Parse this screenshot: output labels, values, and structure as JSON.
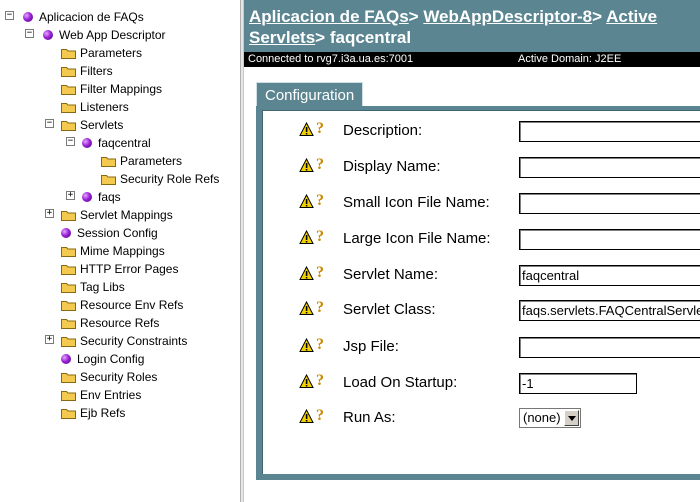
{
  "tree": {
    "root": "Aplicacion de FAQs",
    "descriptor": "Web App Descriptor",
    "parameters": "Parameters",
    "filters": "Filters",
    "filter_mappings": "Filter Mappings",
    "listeners": "Listeners",
    "servlets": "Servlets",
    "faqcentral": "faqcentral",
    "faqcentral_parameters": "Parameters",
    "security_role_refs": "Security Role Refs",
    "faqs": "faqs",
    "servlet_mappings": "Servlet Mappings",
    "session_config": "Session Config",
    "mime_mappings": "Mime Mappings",
    "http_error_pages": "HTTP Error Pages",
    "tag_libs": "Tag Libs",
    "resource_env_refs": "Resource Env Refs",
    "resource_refs": "Resource Refs",
    "security_constraints": "Security Constraints",
    "login_config": "Login Config",
    "security_roles": "Security Roles",
    "env_entries": "Env Entries",
    "ejb_refs": "Ejb Refs"
  },
  "header": {
    "crumb1": "Aplicacion de FAQs",
    "sep1": "> ",
    "crumb2": "WebAppDescriptor-8",
    "sep2": "> ",
    "crumb3a": "Active",
    "crumb3b": "Servlets",
    "sep3": "> ",
    "current": "faqcentral"
  },
  "status": {
    "connected": "Connected to rvg7.i3a.ua.es:7001",
    "domain": "Active Domain: J2EE"
  },
  "tab": {
    "configuration": "Configuration"
  },
  "form": {
    "description_label": "Description",
    "description_value": "",
    "display_name_label": "Display Name",
    "display_name_value": "",
    "small_icon_label": "Small Icon File Name",
    "small_icon_value": "",
    "large_icon_label": "Large Icon File Name",
    "large_icon_value": "",
    "servlet_name_label": "Servlet Name",
    "servlet_name_value": "faqcentral",
    "servlet_class_label": "Servlet Class",
    "servlet_class_value": "faqs.servlets.FAQCentralServlet",
    "jsp_file_label": "Jsp File",
    "jsp_file_value": "",
    "load_on_startup_label": "Load On Startup",
    "load_on_startup_value": "-1",
    "run_as_label": "Run As",
    "run_as_value": "(none)",
    "colon": ":",
    "help_glyph": "?"
  },
  "colors": {
    "header_bg": "#5b8691",
    "status_bg": "#000000",
    "warning_yellow": "#f4d000",
    "help_orange": "#c88a00"
  }
}
